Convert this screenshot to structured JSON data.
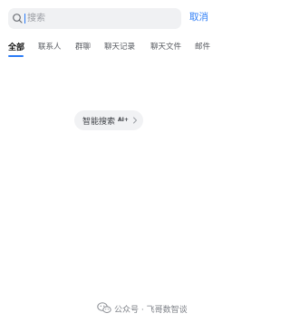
{
  "search": {
    "placeholder": "搜索",
    "cancel_label": "取消"
  },
  "tabs": [
    {
      "label": "全部",
      "active": true
    },
    {
      "label": "联系人",
      "active": false
    },
    {
      "label": "群聊",
      "active": false
    },
    {
      "label": "聊天记录",
      "active": false
    },
    {
      "label": "聊天文件",
      "active": false
    },
    {
      "label": "邮件",
      "active": false
    }
  ],
  "ai_search": {
    "label": "智能搜索",
    "tag": "AI+"
  },
  "watermark": {
    "text": "公众号 · 飞哥数智谈"
  },
  "colors": {
    "accent": "#2a7bf6",
    "search_bg": "#f0f1f3",
    "chip_bg": "#f1f2f4",
    "tab_text": "#55585e"
  }
}
